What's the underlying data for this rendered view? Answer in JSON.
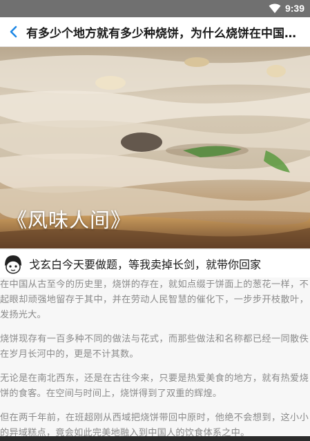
{
  "status_bar": {
    "time": "9:39",
    "icons": [
      "wifi-icon"
    ]
  },
  "app_bar": {
    "back_icon": "chevron-left-icon",
    "title": "有多少个地方就有多少种烧饼，为什么烧饼在中国如此受欢迎？"
  },
  "hero": {
    "caption": "《风味人间》"
  },
  "author": {
    "line": "戈玄白今天要做题，等我卖掉长剑，就带你回家"
  },
  "article": {
    "paragraphs": [
      "在中国从古至今的历史里，烧饼的存在，就如点缀于饼面上的葱花一样，不起眼却顽强地留存于其中，并在劳动人民智慧的催化下，一步步开枝散叶，发扬光大。",
      "烧饼现存有一百多种不同的做法与花式，而那些做法和名称都已经一同散佚在岁月长河中的，更是不计其数。",
      "无论是在南北西东，还是在古往今来，只要是热爱美食的地方，就有热爱烧饼的食客。在空间与时间上，烧饼得到了双重的辉煌。",
      "但在两千年前，在班超刚从西域把烧饼带回中原时，他绝不会想到，这小小的异域糕点，竟会如此完美地融入到中国人的饮食体系之中。"
    ]
  }
}
